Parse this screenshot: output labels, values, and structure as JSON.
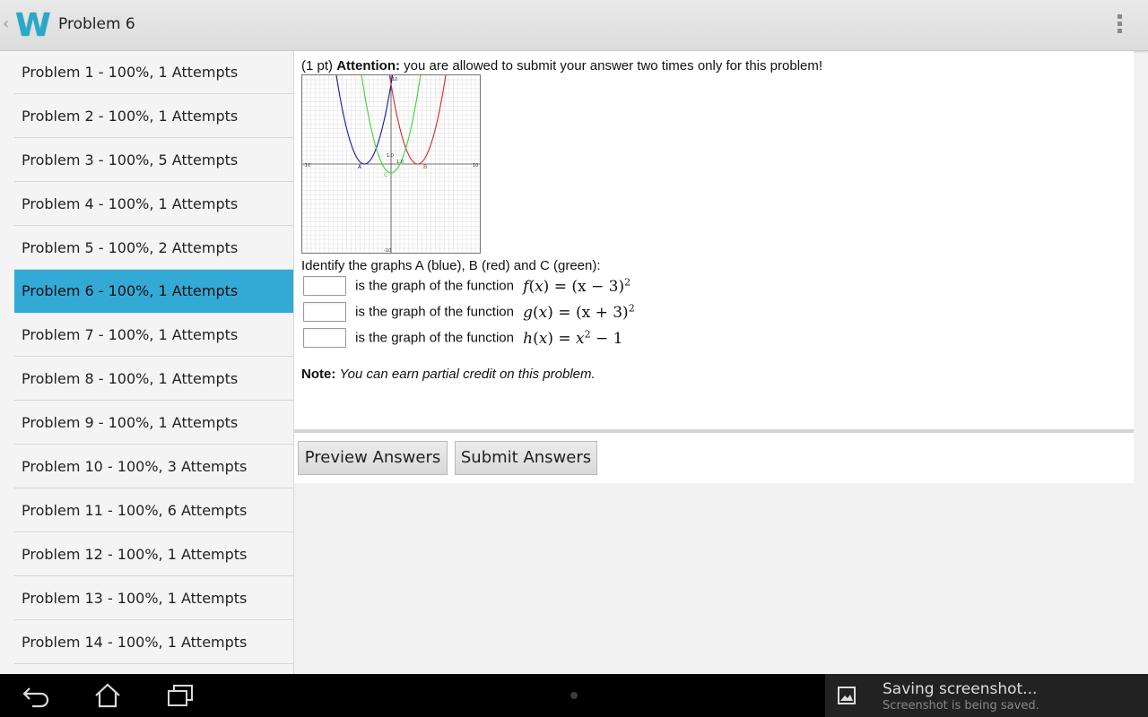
{
  "action_bar": {
    "logo": "W",
    "title": "Problem 6"
  },
  "sidebar": {
    "items": [
      {
        "label": "Problem 1 - 100%, 1 Attempts",
        "selected": false
      },
      {
        "label": "Problem 2 - 100%, 1 Attempts",
        "selected": false
      },
      {
        "label": "Problem 3 - 100%, 5 Attempts",
        "selected": false
      },
      {
        "label": "Problem 4 - 100%, 1 Attempts",
        "selected": false
      },
      {
        "label": "Problem 5 - 100%, 2 Attempts",
        "selected": false
      },
      {
        "label": "Problem 6 - 100%, 1 Attempts",
        "selected": true
      },
      {
        "label": "Problem 7 - 100%, 1 Attempts",
        "selected": false
      },
      {
        "label": "Problem 8 - 100%, 1 Attempts",
        "selected": false
      },
      {
        "label": "Problem 9 - 100%, 1 Attempts",
        "selected": false
      },
      {
        "label": "Problem 10 - 100%, 3 Attempts",
        "selected": false
      },
      {
        "label": "Problem 11 - 100%, 6 Attempts",
        "selected": false
      },
      {
        "label": "Problem 12 - 100%, 1 Attempts",
        "selected": false
      },
      {
        "label": "Problem 13 - 100%, 1 Attempts",
        "selected": false
      },
      {
        "label": "Problem 14 - 100%, 1 Attempts",
        "selected": false
      }
    ]
  },
  "problem": {
    "points": "(1 pt)",
    "attention_label": "Attention:",
    "attention_text": "you are allowed to submit your answer two times only for this problem!",
    "identify_text": "Identify the graphs A (blue), B (red) and C (green):",
    "answer_label": "is the graph of the function",
    "functions": [
      {
        "name": "f",
        "rhs": "(x − 3)",
        "exp": "2"
      },
      {
        "name": "g",
        "rhs": "(x + 3)",
        "exp": "2"
      },
      {
        "name": "h",
        "rhs": "x",
        "exp": "2",
        "tail": "− 1"
      }
    ],
    "answers": [
      "",
      "",
      ""
    ],
    "note_label": "Note:",
    "note_text": "You can earn partial credit on this problem."
  },
  "graph": {
    "axis_labels": {
      "xmin": "-10",
      "xmax": "10",
      "ymax": "10",
      "ymin": "-10",
      "y_tick": "1.0",
      "x_tick": "1.0"
    },
    "point_labels": [
      "A",
      "C",
      "B"
    ],
    "colors": {
      "A": "#1a1a9c",
      "B": "#d42a2a",
      "C": "#3bd63b"
    }
  },
  "buttons": {
    "preview": "Preview Answers",
    "submit": "Submit Answers"
  },
  "notification": {
    "title": "Saving screenshot...",
    "subtitle": "Screenshot is being saved."
  },
  "colors": {
    "accent": "#33a9d6",
    "logo": "#29a9c9"
  }
}
